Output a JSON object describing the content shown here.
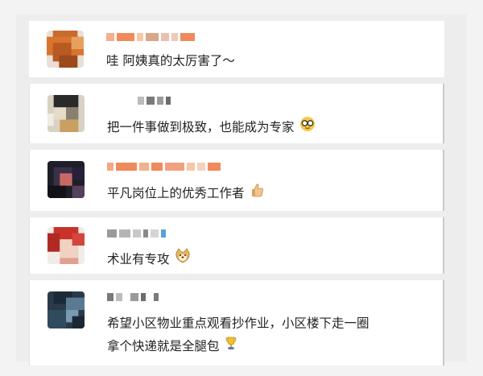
{
  "comments": [
    {
      "text": "哇 阿姨真的太厉害了～",
      "emoji": null
    },
    {
      "text": "把一件事做到极致，也能成为专家",
      "emoji": "nerd-glasses-icon"
    },
    {
      "text": "平凡岗位上的优秀工作者",
      "emoji": "thumbs-up-icon"
    },
    {
      "text": "术业有专攻",
      "emoji": "doge-icon"
    },
    {
      "text_line1": "希望小区物业重点观看抄作业，小区楼下走一圈",
      "text_line2": "拿个快递就是全腿包",
      "emoji": "trophy-icon"
    }
  ],
  "colors": {
    "background": "#f3f3f3",
    "card": "#ffffff",
    "text": "#222222",
    "name_blur_orange": "#f08a5d",
    "name_blur_gray": "#9a9a9a"
  }
}
